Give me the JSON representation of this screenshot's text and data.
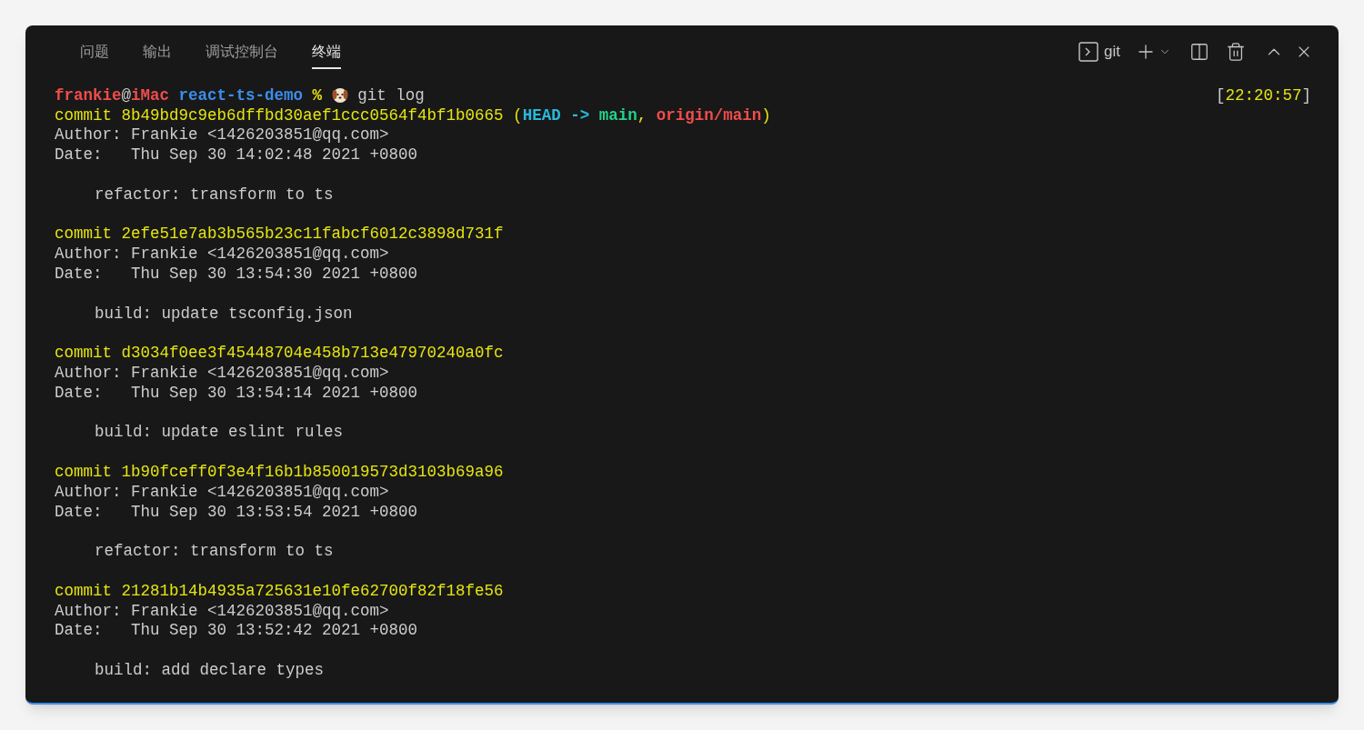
{
  "tabs": [
    {
      "label": "问题",
      "selected": false
    },
    {
      "label": "输出",
      "selected": false
    },
    {
      "label": "调试控制台",
      "selected": false
    },
    {
      "label": "终端",
      "selected": true
    }
  ],
  "toolbar": {
    "shell": "git"
  },
  "prompt": {
    "user": "frankie",
    "at": "@",
    "host": "iMac",
    "dir": "react-ts-demo",
    "symbol": "%",
    "command": "git log",
    "time_open": "[",
    "time": "22:20:57",
    "time_close": "]"
  },
  "commits": [
    {
      "commit": "commit 8b49bd9c9eb6dffbd30aef1ccc0564f4bf1b0665",
      "refs": [
        {
          "kind": "punct",
          "text": "("
        },
        {
          "kind": "head",
          "text": "HEAD ->"
        },
        {
          "kind": "branch",
          "text": "main"
        },
        {
          "kind": "punct",
          "text": ","
        },
        {
          "kind": "remote",
          "text": "origin/main"
        },
        {
          "kind": "punct",
          "text": ")"
        }
      ],
      "author": "Author: Frankie <1426203851@qq.com>",
      "date": "Date:   Thu Sep 30 14:02:48 2021 +0800",
      "message": "refactor: transform to ts"
    },
    {
      "commit": "commit 2efe51e7ab3b565b23c11fabcf6012c3898d731f",
      "author": "Author: Frankie <1426203851@qq.com>",
      "date": "Date:   Thu Sep 30 13:54:30 2021 +0800",
      "message": "build: update tsconfig.json"
    },
    {
      "commit": "commit d3034f0ee3f45448704e458b713e47970240a0fc",
      "author": "Author: Frankie <1426203851@qq.com>",
      "date": "Date:   Thu Sep 30 13:54:14 2021 +0800",
      "message": "build: update eslint rules"
    },
    {
      "commit": "commit 1b90fceff0f3e4f16b1b850019573d3103b69a96",
      "author": "Author: Frankie <1426203851@qq.com>",
      "date": "Date:   Thu Sep 30 13:53:54 2021 +0800",
      "message": "refactor: transform to ts"
    },
    {
      "commit": "commit 21281b14b4935a725631e10fe62700f82f18fe56",
      "author": "Author: Frankie <1426203851@qq.com>",
      "date": "Date:   Thu Sep 30 13:52:42 2021 +0800",
      "message": "build: add declare types"
    }
  ]
}
